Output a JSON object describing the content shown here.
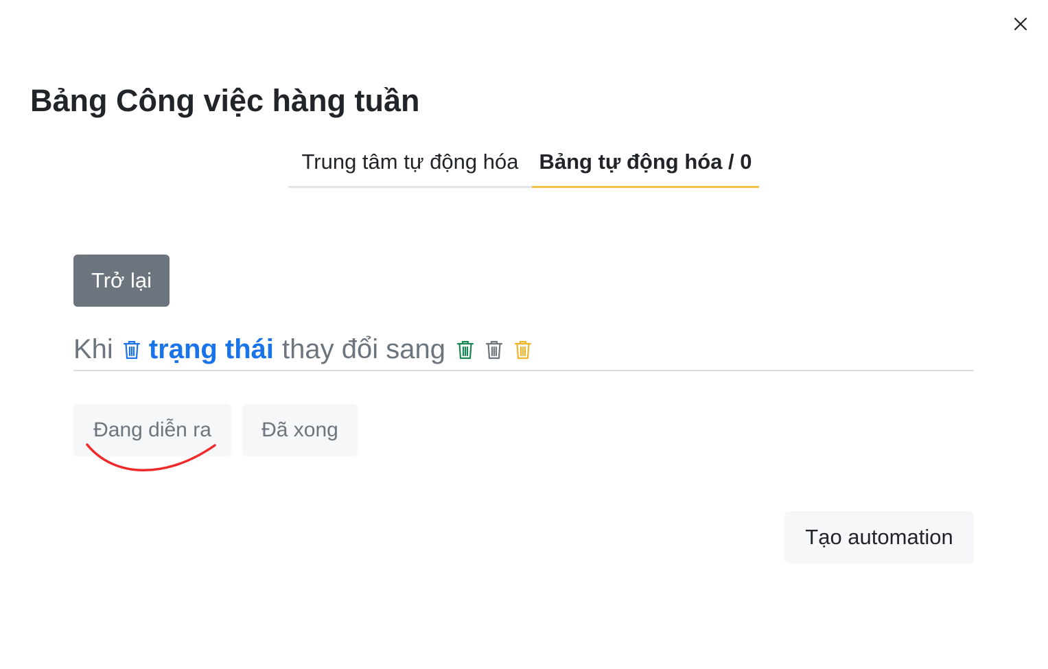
{
  "modal": {
    "title": "Bảng Công việc hàng tuần",
    "close_icon": "close-icon"
  },
  "tabs": [
    {
      "label": "Trung tâm tự động hóa",
      "active": false
    },
    {
      "label": "Bảng tự động hóa / 0",
      "active": true
    }
  ],
  "tab_active_color": "#f3c14a",
  "back_button": {
    "label": "Trở lại",
    "color": "#6c757d"
  },
  "rule": {
    "prefix": "Khi",
    "field": "trạng thái",
    "verb": "thay đổi sang",
    "field_color": "#1a73e8",
    "icons": [
      {
        "name": "trash-icon",
        "color": "#1a73e8"
      },
      {
        "name": "trash-icon",
        "color": "#198754"
      },
      {
        "name": "trash-icon",
        "color": "#6c757d"
      },
      {
        "name": "trash-icon",
        "color": "#f0b429"
      }
    ]
  },
  "status_options": [
    {
      "label": "Đang diễn ra",
      "annotated": true
    },
    {
      "label": "Đã xong",
      "annotated": false
    }
  ],
  "annotation_color": "#f02a2a",
  "create_button": {
    "label": "Tạo automation"
  }
}
